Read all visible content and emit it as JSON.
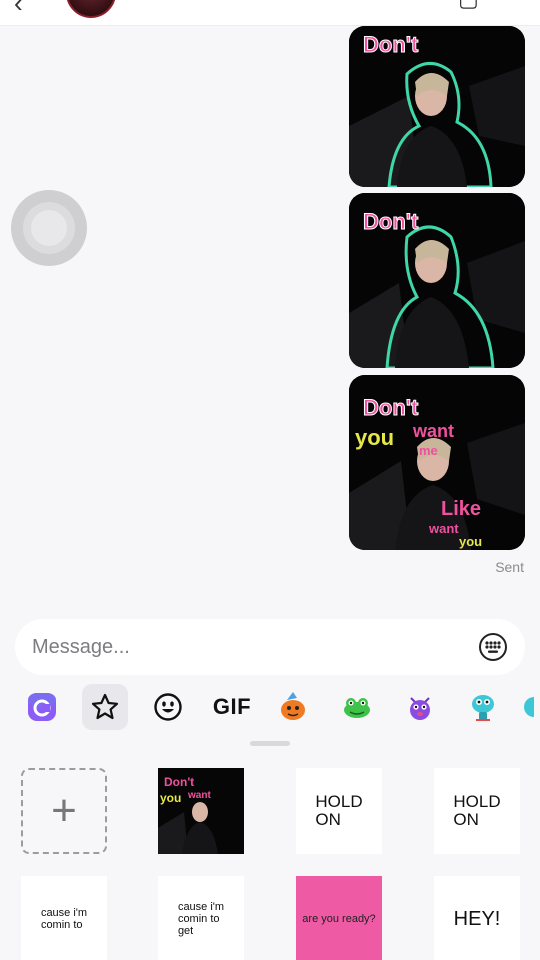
{
  "header": {
    "back_icon": "back-arrow-icon",
    "video_icon": "video-call-icon"
  },
  "messages": {
    "stickers": [
      {
        "caption_lines": [
          "Don't"
        ]
      },
      {
        "caption_lines": [
          "Don't"
        ]
      },
      {
        "caption_lines": [
          "Don't",
          "you",
          "want",
          "me",
          "Like",
          "want",
          "you"
        ]
      }
    ],
    "status": "Sent"
  },
  "composer": {
    "placeholder": "Message...",
    "keyboard_icon": "keyboard-icon"
  },
  "tabs": {
    "items": [
      {
        "name": "app-logo-icon"
      },
      {
        "name": "favorites-star-icon",
        "active": true
      },
      {
        "name": "emoji-icon"
      },
      {
        "label": "GIF"
      },
      {
        "name": "orange-character-sticker-icon"
      },
      {
        "name": "frog-sticker-icon"
      },
      {
        "name": "purple-monster-sticker-icon"
      },
      {
        "name": "cyan-creature-sticker-icon"
      }
    ]
  },
  "sticker_grid": {
    "add_icon": "plus-icon",
    "items": [
      {
        "lines": [
          "HOLD",
          "ON"
        ]
      },
      {
        "lines": [
          "HOLD",
          "ON"
        ]
      },
      {
        "lines": [
          "cause i'm",
          "comin  to"
        ]
      },
      {
        "lines": [
          "cause i'm",
          "comin  to",
          "get"
        ]
      },
      {
        "text": "are you ready?"
      },
      {
        "text": "HEY!"
      }
    ],
    "preview_caption": [
      "Don't",
      "you",
      "want"
    ]
  },
  "colors": {
    "background": "#f7f6f9",
    "sticker_pink": "#f0519e",
    "sticker_yellow": "#e6e84a",
    "outline_teal": "#3fd6a8",
    "pink_tile": "#ef5aa5"
  }
}
